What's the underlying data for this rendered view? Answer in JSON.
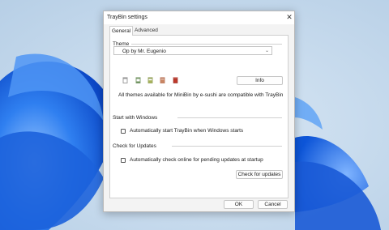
{
  "window": {
    "title": "TrayBin settings"
  },
  "tabs": [
    {
      "label": "General"
    },
    {
      "label": "Advanced"
    }
  ],
  "theme": {
    "group_label": "Theme",
    "selected": "Op by Mr. Eugenio",
    "info_button": "Info",
    "note": "All themes available for MiniBin by e-sushi are compatible with TrayBin",
    "bin_icons": [
      "trash-empty-icon",
      "trash-quarter-icon",
      "trash-half-icon",
      "trash-three-quarter-icon",
      "trash-full-icon"
    ]
  },
  "startup": {
    "group_label": "Start with Windows",
    "checkbox_label": "Automatically start TrayBin when Windows starts",
    "checked": false
  },
  "updates": {
    "group_label": "Check for Updates",
    "checkbox_label": "Automatically check online for pending updates at startup",
    "checked": false,
    "button": "Check for updates"
  },
  "footer": {
    "ok": "OK",
    "cancel": "Cancel"
  },
  "colors": {
    "dialog_bg": "#f3f3f3",
    "panel_bg": "#ffffff",
    "bin_full": "#c0392b",
    "bin_empty": "#8a8a8a",
    "desktop_accent": "#1f6fe0"
  }
}
